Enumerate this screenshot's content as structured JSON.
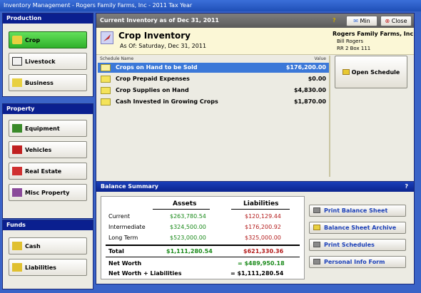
{
  "window": {
    "title": "Inventory Management - Rogers Family Farms, Inc - 2011 Tax Year"
  },
  "sidebar": {
    "production": {
      "header": "Production",
      "items": [
        {
          "label": "Crop",
          "icon": "crop-icon",
          "active": true
        },
        {
          "label": "Livestock",
          "icon": "livestock-icon"
        },
        {
          "label": "Business",
          "icon": "business-icon"
        }
      ]
    },
    "property": {
      "header": "Property",
      "items": [
        {
          "label": "Equipment",
          "icon": "equipment-icon"
        },
        {
          "label": "Vehicles",
          "icon": "vehicles-icon"
        },
        {
          "label": "Real Estate",
          "icon": "real-estate-icon"
        },
        {
          "label": "Misc Property",
          "icon": "misc-property-icon"
        }
      ]
    },
    "funds": {
      "header": "Funds",
      "items": [
        {
          "label": "Cash",
          "icon": "cash-icon"
        },
        {
          "label": "Liabilities",
          "icon": "liabilities-icon"
        }
      ]
    }
  },
  "inventory": {
    "header": "Current Inventory as of Dec 31, 2011",
    "help": "?",
    "min_label": "Min",
    "close_label": "Close",
    "title": "Crop Inventory",
    "as_of": "As Of: Saturday, Dec 31, 2011",
    "farm": {
      "name": "Rogers Family Farms, Inc",
      "line1": "Bill Rogers",
      "line2": "RR 2  Box 111"
    },
    "col_name": "Schedule Name",
    "col_value": "Value",
    "rows": [
      {
        "name": "Crops on Hand to be Sold",
        "value": "$176,200.00",
        "selected": true
      },
      {
        "name": "Crop Prepaid Expenses",
        "value": "$0.00"
      },
      {
        "name": "Crop Supplies on Hand",
        "value": "$4,830.00"
      },
      {
        "name": "Cash Invested in Growing Crops",
        "value": "$1,870.00"
      }
    ],
    "open_schedule_label": "Open Schedule"
  },
  "balance": {
    "header": "Balance Summary",
    "help": "?",
    "assets_label": "Assets",
    "liabilities_label": "Liabilities",
    "rows": [
      {
        "label": "Current",
        "assets": "$263,780.54",
        "liabilities": "$120,129.44"
      },
      {
        "label": "Intermediate",
        "assets": "$324,500.00",
        "liabilities": "$176,200.92"
      },
      {
        "label": "Long Term",
        "assets": "$523,000.00",
        "liabilities": "$325,000.00"
      }
    ],
    "total": {
      "label": "Total",
      "assets": "$1,111,280.54",
      "liabilities": "$621,330.36"
    },
    "net_worth": {
      "label": "Net Worth",
      "value": "= $489,950.18"
    },
    "net_worth_liab": {
      "label": "Net Worth + Liabilities",
      "value": "= $1,111,280.54"
    },
    "buttons": [
      {
        "label": "Print Balance Sheet"
      },
      {
        "label": "Balance Sheet Archive"
      },
      {
        "label": "Print Schedules"
      },
      {
        "label": "Personal Info Form"
      }
    ]
  },
  "colors": {
    "accent": "#0a1f8f",
    "active_green": "#2fb12a",
    "selection": "#3b78d8",
    "assets_green": "#1a8a1a",
    "liabilities_red": "#b31b1b"
  }
}
